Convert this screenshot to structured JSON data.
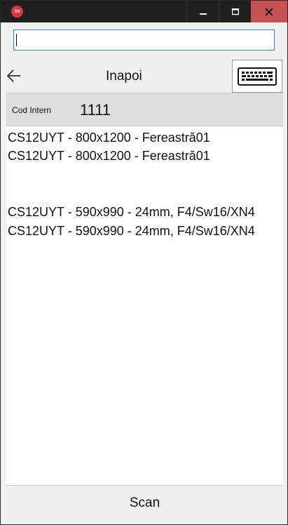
{
  "titlebar": {
    "app_icon_text": "DX",
    "icons": [
      "app-logo-icon",
      "minimize-icon",
      "maximize-icon",
      "close-icon"
    ],
    "close_button_color": "#c55353"
  },
  "search": {
    "value": "",
    "placeholder": ""
  },
  "nav": {
    "back_label": "Inapoi",
    "back_icon": "arrow-left-icon",
    "keyboard_icon": "keyboard-icon"
  },
  "cod": {
    "label": "Cod Intern",
    "value": "1111"
  },
  "list": {
    "items": [
      {
        "text": "CS12UYT - 800x1200 - Fereastră01"
      },
      {
        "text": "CS12UYT - 800x1200 - Fereastră01"
      },
      {
        "text": "CS12UYT - 590x990 - 24mm, F4/Sw16/XN4"
      },
      {
        "text": "CS12UYT - 590x990 - 24mm, F4/Sw16/XN4"
      }
    ]
  },
  "footer": {
    "scan_label": "Scan"
  },
  "colors": {
    "accent": "#3a7bd5",
    "titlebar": "#1f1f1f",
    "header_row": "#dedede"
  }
}
